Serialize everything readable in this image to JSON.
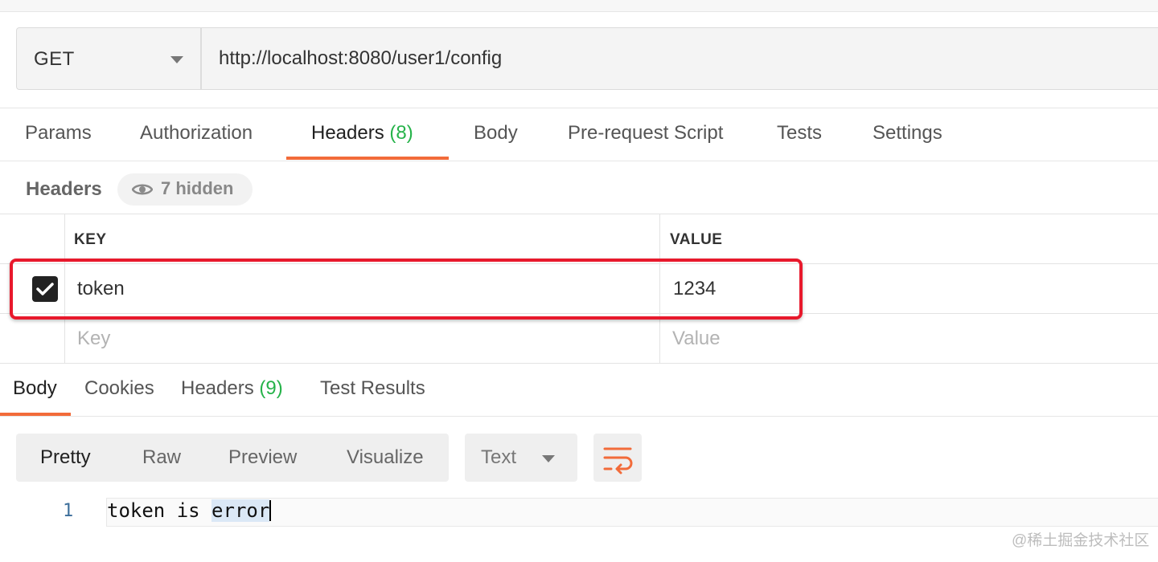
{
  "request": {
    "method": "GET",
    "url": "http://localhost:8080/user1/config"
  },
  "request_tabs": {
    "params": "Params",
    "authorization": "Authorization",
    "headers": "Headers",
    "headers_count": "(8)",
    "body": "Body",
    "pre_request": "Pre-request Script",
    "tests": "Tests",
    "settings": "Settings"
  },
  "headers_section": {
    "title": "Headers",
    "hidden_label": "7 hidden",
    "key_col": "KEY",
    "value_col": "VALUE",
    "rows": [
      {
        "key": "token",
        "value": "1234",
        "enabled": true
      }
    ],
    "key_placeholder": "Key",
    "value_placeholder": "Value"
  },
  "response_tabs": {
    "body": "Body",
    "cookies": "Cookies",
    "headers": "Headers",
    "headers_count": "(9)",
    "test_results": "Test Results"
  },
  "format_toolbar": {
    "pretty": "Pretty",
    "raw": "Raw",
    "preview": "Preview",
    "visualize": "Visualize",
    "content_type": "Text"
  },
  "response_body": {
    "line_number": "1",
    "text_plain": "token is ",
    "text_selected": "error"
  },
  "watermark": "@稀土掘金技术社区",
  "colors": {
    "accent_orange": "#f26b3a",
    "count_green": "#26b34a",
    "highlight_red": "#e8192c"
  }
}
